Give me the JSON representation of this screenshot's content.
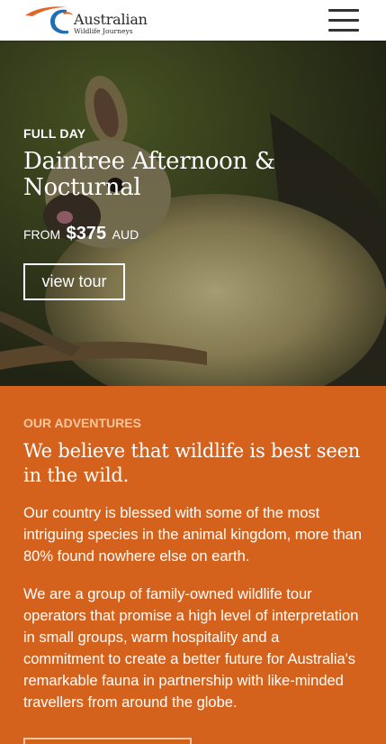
{
  "header": {
    "logo_title": "Australian",
    "logo_subtitle": "Wildlife Journeys",
    "menu_icon": "hamburger-menu-icon"
  },
  "hero": {
    "kicker": "FULL DAY",
    "title": "Daintree Afternoon & Nocturnal",
    "price_prefix": "FROM",
    "price_amount": "$375",
    "price_currency": "AUD",
    "button_label": "view tour"
  },
  "adventures": {
    "kicker": "OUR ADVENTURES",
    "heading": "We believe that wildlife is best seen in the wild.",
    "paragraph_1": "Our country is blessed with some of the most intriguing species in the animal kingdom, more than 80% found nowhere else on earth.",
    "paragraph_2": "We are a group of family-owned wildlife tour operators that promise a high level of interpretation in small groups, warm hospitality and a commitment to create a better future for Australia's remarkable fauna in partnership with like-minded travellers from around the globe.",
    "button_label": ""
  },
  "colors": {
    "accent_orange": "#d4621d",
    "kicker_peach": "#f6c79f",
    "logo_blue": "#1e6fb3",
    "logo_orange": "#e0672a"
  }
}
